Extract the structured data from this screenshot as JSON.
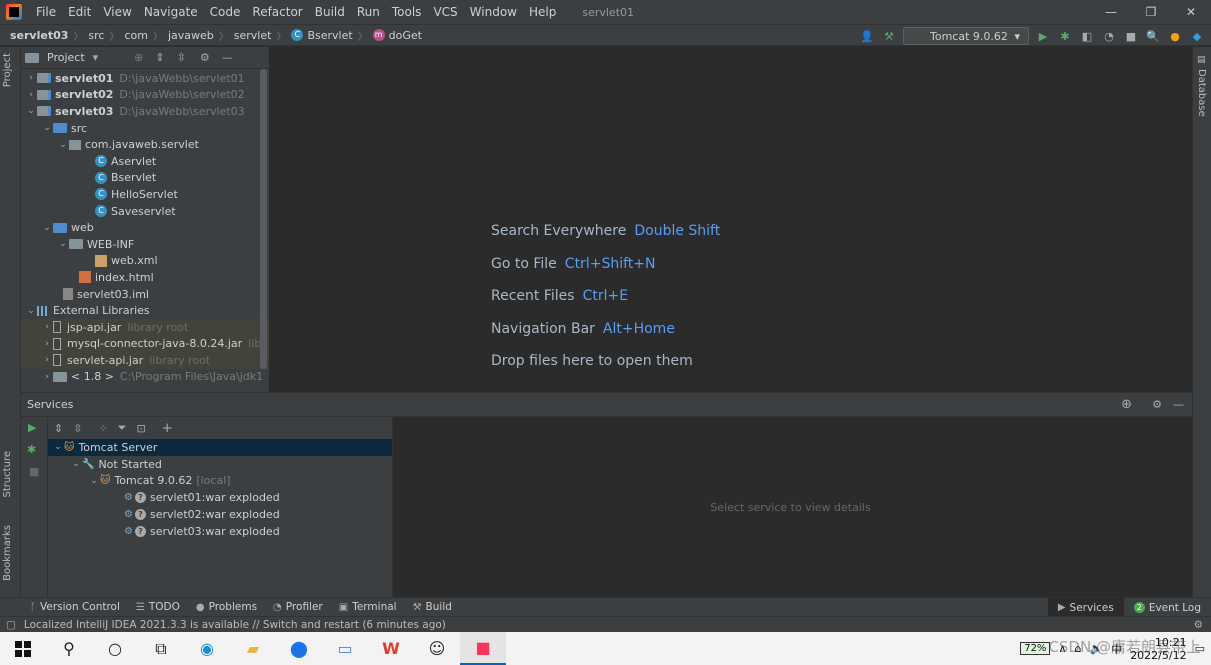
{
  "titlebar": {
    "menu": [
      "File",
      "Edit",
      "View",
      "Navigate",
      "Code",
      "Refactor",
      "Build",
      "Run",
      "Tools",
      "VCS",
      "Window",
      "Help"
    ],
    "window_title": "servlet01",
    "min": "—",
    "restore": "❐",
    "close": "✕"
  },
  "navbar": {
    "crumbs": [
      "servlet03",
      "src",
      "com",
      "javaweb",
      "servlet",
      "Bservlet",
      "doGet"
    ],
    "class_glyph": "C",
    "method_glyph": "m",
    "run_config": "Tomcat 9.0.62"
  },
  "stripes": {
    "left_top": "Project",
    "left_mid": "Structure",
    "left_bottom": "Bookmarks",
    "right": "Database"
  },
  "project": {
    "header": "Project",
    "tree": [
      {
        "name": "servlet01",
        "path": "D:\\javaWebb\\servlet01"
      },
      {
        "name": "servlet02",
        "path": "D:\\javaWebb\\servlet02"
      },
      {
        "name": "servlet03",
        "path": "D:\\javaWebb\\servlet03"
      },
      {
        "name": "src"
      },
      {
        "name": "com.javaweb.servlet"
      },
      {
        "name": "Aservlet"
      },
      {
        "name": "Bservlet"
      },
      {
        "name": "HelloServlet"
      },
      {
        "name": "Saveservlet"
      },
      {
        "name": "web"
      },
      {
        "name": "WEB-INF"
      },
      {
        "name": "web.xml"
      },
      {
        "name": "index.html"
      },
      {
        "name": "servlet03.iml"
      },
      {
        "name": "External Libraries"
      },
      {
        "name": "jsp-api.jar",
        "lib": "library root"
      },
      {
        "name": "mysql-connector-java-8.0.24.jar",
        "lib": "lib"
      },
      {
        "name": "servlet-api.jar",
        "lib": "library root"
      },
      {
        "name": "< 1.8 >",
        "path": "C:\\Program Files\\Java\\jdk1"
      }
    ]
  },
  "editor": {
    "hints": [
      {
        "label": "Search Everywhere",
        "key": "Double Shift"
      },
      {
        "label": "Go to File",
        "key": "Ctrl+Shift+N"
      },
      {
        "label": "Recent Files",
        "key": "Ctrl+E"
      },
      {
        "label": "Navigation Bar",
        "key": "Alt+Home"
      },
      {
        "label": "Drop files here to open them",
        "key": ""
      }
    ]
  },
  "services": {
    "header": "Services",
    "tree": [
      {
        "name": "Tomcat Server"
      },
      {
        "name": "Not Started"
      },
      {
        "name": "Tomcat 9.0.62",
        "suffix": "[local]"
      },
      {
        "name": "servlet01:war exploded"
      },
      {
        "name": "servlet02:war exploded"
      },
      {
        "name": "servlet03:war exploded"
      }
    ],
    "detail_placeholder": "Select service to view details"
  },
  "tooltabs": {
    "left": [
      "Version Control",
      "TODO",
      "Problems",
      "Profiler",
      "Terminal",
      "Build"
    ],
    "right": [
      "Services",
      "Event Log"
    ],
    "event_count": "2"
  },
  "statusbar": {
    "message": "Localized IntelliJ IDEA 2021.3.3 is available // Switch and restart (6 minutes ago)"
  },
  "taskbar": {
    "battery": "72%",
    "time": "10:21",
    "date": "2022/5/12",
    "ime": "中",
    "watermark": "CSDN @庸若朗县带上"
  },
  "colors": {
    "accent": "#589df6",
    "ide_bg": "#2b2b2b",
    "panel_bg": "#3c3f41",
    "selection": "#0d293e"
  }
}
